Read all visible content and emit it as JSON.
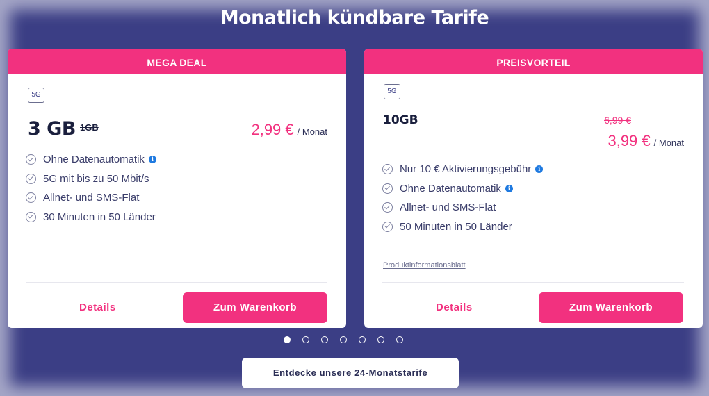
{
  "page": {
    "title": "Monatlich kündbare Tarife"
  },
  "offers": [
    {
      "ribbon": "MEGA DEAL",
      "network": "5G",
      "volume": "3 GB",
      "old_volume": "1GB",
      "price": "2,99 €",
      "per": "/ Monat",
      "features": [
        "Ohne Datenautomatik",
        "5G mit bis zu 50 Mbit/s",
        "Allnet- und SMS-Flat",
        "30 Minuten in 50 Länder"
      ],
      "details": "Details",
      "cart": "Zum Warenkorb"
    },
    {
      "ribbon": "PREISVORTEIL",
      "network": "5G",
      "volume": "10GB",
      "old_price": "6,99 €",
      "price": "3,99 €",
      "per": "/ Monat",
      "features": [
        "Nur 10 € Aktivierungsgebühr",
        "Ohne Datenautomatik",
        "Allnet- und SMS-Flat",
        "50 Minuten in 50 Länder"
      ],
      "product_info": "Produktinformationsblatt",
      "details": "Details",
      "cart": "Zum Warenkorb"
    }
  ],
  "carousel": {
    "total": 7,
    "active": 1
  },
  "more_button": "Entdecke unsere 24-Monatstarife",
  "icons": {
    "check": "check-circle-icon",
    "info": "info-icon"
  },
  "colors": {
    "background": "#3b3e85",
    "accent": "#f2317f",
    "text": "#1a1f3d"
  }
}
